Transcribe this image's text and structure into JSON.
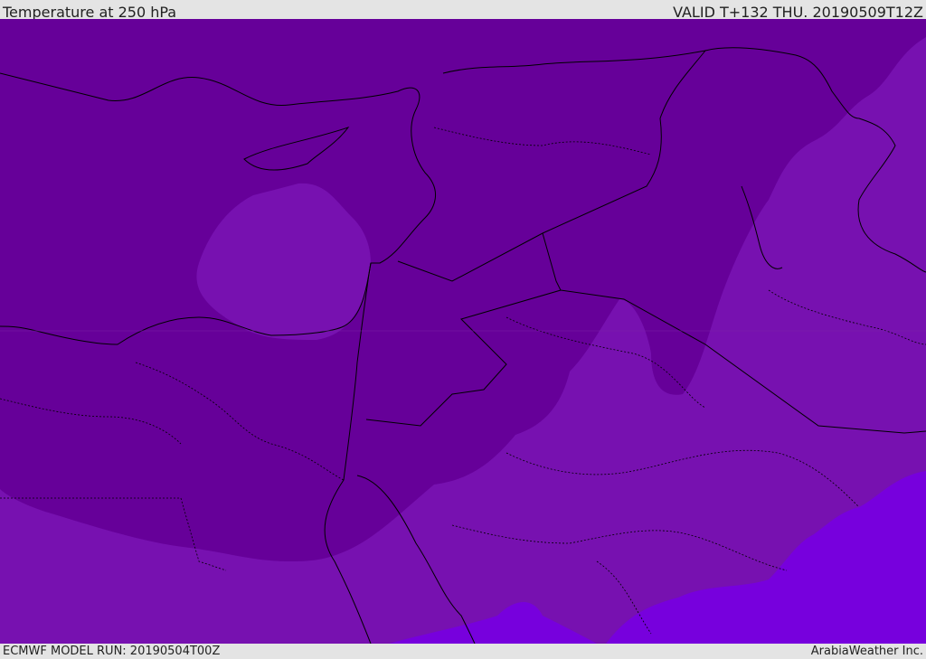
{
  "header": {
    "title": "Temperature at 250 hPa",
    "valid": "VALID T+132 THU. 20190509T12Z"
  },
  "footer": {
    "model_run": "ECMWF MODEL RUN: 20190504T00Z",
    "credit": "ArabiaWeather Inc."
  },
  "colors": {
    "cold_fill": "#660099",
    "mid_fill": "#7711b0",
    "warm_fill": "#7700dd",
    "border_line": "#000000"
  }
}
